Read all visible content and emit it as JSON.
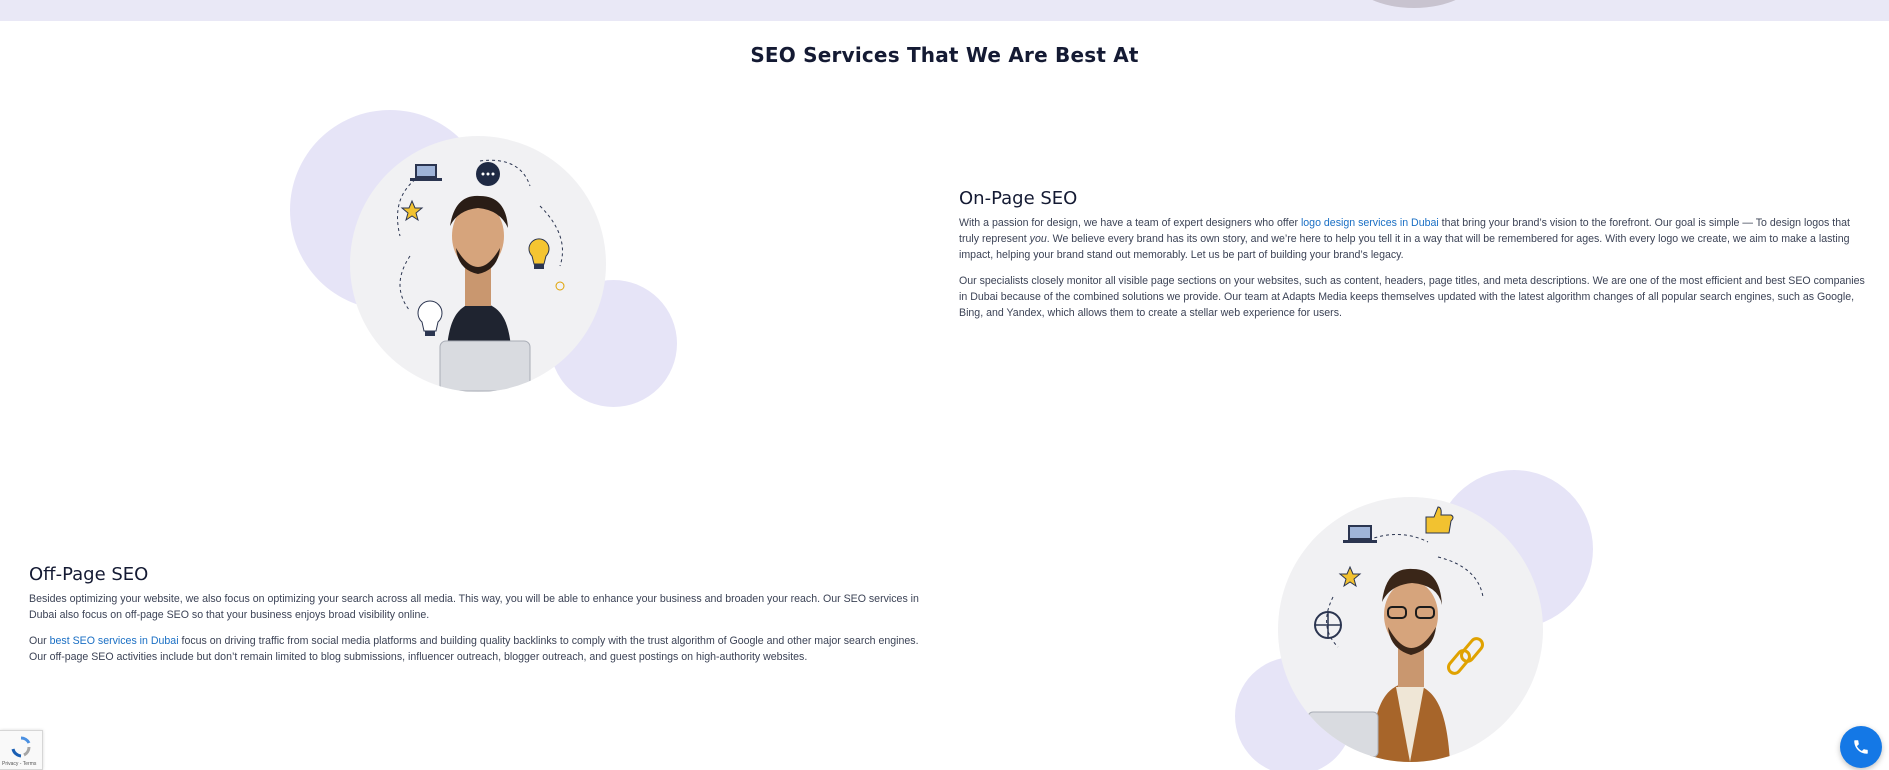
{
  "section": {
    "title": "SEO Services That We Are Best At"
  },
  "on_page": {
    "title": "On-Page SEO",
    "p1_before": "With a passion for design, we have a team of expert designers who offer ",
    "p1_link": "logo design services in Dubai",
    "p1_mid": " that bring your brand’s vision to the forefront. Our goal is simple — To design logos that truly represent ",
    "p1_em": "you",
    "p1_after": ". We believe every brand has its own story, and we’re here to help you tell it in a way that will be remembered for ages. With every logo we create, we aim to make a lasting impact, helping your brand stand out memorably. Let us be part of building your brand’s legacy.",
    "p2": "Our specialists closely monitor all visible page sections on your websites, such as content, headers, page titles, and meta descriptions. We are one of the most efficient and best SEO companies in Dubai because of the combined solutions we provide. Our team at Adapts Media keeps themselves updated with the latest algorithm changes of all popular search engines, such as Google, Bing, and Yandex, which allows them to create a stellar web experience for users."
  },
  "off_page": {
    "title": "Off-Page SEO",
    "p1": "Besides optimizing your website, we also focus on optimizing your search across all media. This way, you will be able to enhance your business and broaden your reach. Our SEO services in Dubai also focus on off-page SEO so that your business enjoys broad visibility online.",
    "p2_before": "Our ",
    "p2_link": "best SEO services in Dubai",
    "p2_after": " focus on driving traffic from social media platforms and building quality backlinks to comply with the trust algorithm of Google and other major search engines. Our off-page SEO activities include but don’t remain limited to blog submissions, influencer outreach, blogger outreach, and guest postings on high-authority websites."
  },
  "recaptcha": {
    "text": "Privacy - Terms",
    "icon": "recaptcha-icon"
  },
  "call_button": {
    "icon": "phone-icon"
  },
  "colors": {
    "accent_blob": "#e6e4f7",
    "link": "#1a6fc4",
    "call_button": "#1478e6",
    "heading": "#141a33"
  }
}
